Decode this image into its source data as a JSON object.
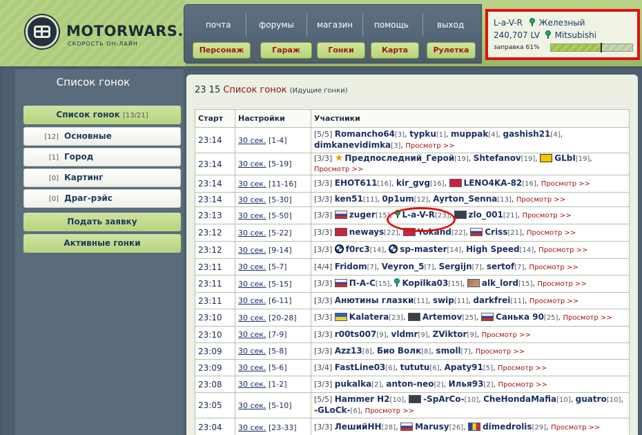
{
  "logo": {
    "name": "MOTORWARS.RU",
    "tagline": "СКОРОСТЬ ОН-ЛАЙН"
  },
  "nav": {
    "top": [
      "почта",
      "форумы",
      "магазин",
      "помощь",
      "выход"
    ],
    "buttons": [
      "Персонаж",
      "Гараж",
      "Гонки",
      "Карта",
      "Рулетка"
    ]
  },
  "status": {
    "nick": "L-a-V-R",
    "rank": "Железный",
    "money": "240,707 LV",
    "car": "Mitsubishi",
    "fuel_label": "заправка 61%",
    "fuel_percent": 61
  },
  "sidebar": {
    "title": "Список гонок",
    "list_label": "Список гонок",
    "list_count": "[13/21]",
    "categories": [
      {
        "count": "[12]",
        "label": "Основные"
      },
      {
        "count": "[1]",
        "label": "Город"
      },
      {
        "count": "[0]",
        "label": "Картинг"
      },
      {
        "count": "[0]",
        "label": "Драг-рэйс"
      }
    ],
    "submit_label": "Подать заявку",
    "active_label": "Активные гонки"
  },
  "main": {
    "heading_time": "23 15",
    "heading_title": "Список гонок",
    "heading_sub": "(Идущие гонки)",
    "columns": [
      "Старт",
      "Настройки",
      "Участники"
    ],
    "view_label": "Просмотр >>",
    "rows": [
      {
        "start": "23:14",
        "setting": "30 сек.",
        "range": "[1-4]",
        "count": "[5/5]",
        "players": [
          [
            "Romancho64",
            "[3]"
          ],
          [
            "typku",
            "[1]"
          ],
          [
            "muppak",
            "[4]"
          ],
          [
            "gashish21",
            "[4]"
          ],
          [
            "dimkanevidimka",
            "[3]"
          ]
        ]
      },
      {
        "start": "23:14",
        "setting": "30 сек.",
        "range": "[5-19]",
        "count": "[3/3]",
        "players": [
          [
            "Предпоследний_Герой",
            "[19]"
          ],
          [
            "Shtefanov",
            "[19]"
          ],
          [
            "GLbI",
            "[19]"
          ]
        ]
      },
      {
        "start": "23:14",
        "setting": "30 сек.",
        "range": "[11-16]",
        "count": "[3/3]",
        "players": [
          [
            "EHOT611",
            "[16]"
          ],
          [
            "kir_gvg",
            "[16]"
          ],
          [
            "LENO4KA-82",
            "[16]"
          ]
        ]
      },
      {
        "start": "23:14",
        "setting": "30 сек.",
        "range": "[5-30]",
        "count": "[3/3]",
        "players": [
          [
            "ken51",
            "[11]"
          ],
          [
            "0p1um",
            "[12]"
          ],
          [
            "Ayrton_Senna",
            "[13]"
          ]
        ]
      },
      {
        "start": "23:13",
        "setting": "30 сек.",
        "range": "[5-50]",
        "count": "[3/3]",
        "players": [
          [
            "zuger",
            "[15]"
          ],
          [
            "L-a-V-R",
            "[23]"
          ],
          [
            "zlo_001",
            "[21]"
          ]
        ]
      },
      {
        "start": "23:12",
        "setting": "30 сек.",
        "range": "[5-22]",
        "count": "[3/3]",
        "players": [
          [
            "neways",
            "[22]"
          ],
          [
            "Yokand",
            "[22]"
          ],
          [
            "Criss",
            "[21]"
          ]
        ]
      },
      {
        "start": "23:12",
        "setting": "30 сек.",
        "range": "[9-14]",
        "count": "[3/3]",
        "players": [
          [
            "f0rc3",
            "[14]"
          ],
          [
            "sp-master",
            "[14]"
          ],
          [
            "High Speed",
            "[14]"
          ]
        ]
      },
      {
        "start": "23:11",
        "setting": "30 сек.",
        "range": "[5-7]",
        "count": "[4/4]",
        "players": [
          [
            "Fridom",
            "[7]"
          ],
          [
            "Veyron_5",
            "[7]"
          ],
          [
            "Sergijn",
            "[7]"
          ],
          [
            "sertof",
            "[7]"
          ]
        ]
      },
      {
        "start": "23:11",
        "setting": "30 сек.",
        "range": "[5-15]",
        "count": "[3/3]",
        "players": [
          [
            "П-А-С",
            "[15]"
          ],
          [
            "Kopilka03",
            "[15]"
          ],
          [
            "alk_lord",
            "[15]"
          ]
        ]
      },
      {
        "start": "23:11",
        "setting": "30 сек.",
        "range": "[6-11]",
        "count": "[3/3]",
        "players": [
          [
            "Анютины глазки",
            "[11]"
          ],
          [
            "swip",
            "[11]"
          ],
          [
            "darkfrei",
            "[11]"
          ]
        ]
      },
      {
        "start": "23:10",
        "setting": "30 сек.",
        "range": "[20-28]",
        "count": "[3/3]",
        "players": [
          [
            "Kalatera",
            "[23]"
          ],
          [
            "Artemov",
            "[25]"
          ],
          [
            "Санька 90",
            "[25]"
          ]
        ]
      },
      {
        "start": "23:10",
        "setting": "30 сек.",
        "range": "[7-9]",
        "count": "[3/3]",
        "players": [
          [
            "r00ts007",
            "[9]"
          ],
          [
            "vldmr",
            "[9]"
          ],
          [
            "ZViktor",
            "[9]"
          ]
        ]
      },
      {
        "start": "23:09",
        "setting": "30 сек.",
        "range": "[5-8]",
        "count": "[3/3]",
        "players": [
          [
            "Azz13",
            "[8]"
          ],
          [
            "Био Волк",
            "[8]"
          ],
          [
            "smoll",
            "[7]"
          ]
        ]
      },
      {
        "start": "23:09",
        "setting": "30 сек.",
        "range": "[5-6]",
        "count": "[3/4]",
        "players": [
          [
            "FastLine03",
            "[6]"
          ],
          [
            "tututu",
            "[6]"
          ],
          [
            "Apaty91",
            "[5]"
          ]
        ]
      },
      {
        "start": "23:08",
        "setting": "30 сек.",
        "range": "[1-2]",
        "count": "[3/3]",
        "players": [
          [
            "pukalka",
            "[2]"
          ],
          [
            "anton-neo",
            "[2]"
          ],
          [
            "Илья93",
            "[2]"
          ]
        ]
      },
      {
        "start": "23:05",
        "setting": "30 сек.",
        "range": "[5-10]",
        "count": "[5/5]",
        "players": [
          [
            "Hammer H2",
            "[10]"
          ],
          [
            "-SpArCo-",
            "[10]"
          ],
          [
            "CheHondaMafia",
            "[10]"
          ],
          [
            "guatro",
            "[10]"
          ],
          [
            "-GLoCk-",
            "[6]"
          ]
        ]
      },
      {
        "start": "23:04",
        "setting": "30 сек.",
        "range": "[23-33]",
        "count": "[3/3]",
        "players": [
          [
            "ЛешийHH",
            "[28]"
          ],
          [
            "Marusy",
            "[26]"
          ],
          [
            "dimedrolis",
            "[29]"
          ]
        ]
      }
    ]
  }
}
